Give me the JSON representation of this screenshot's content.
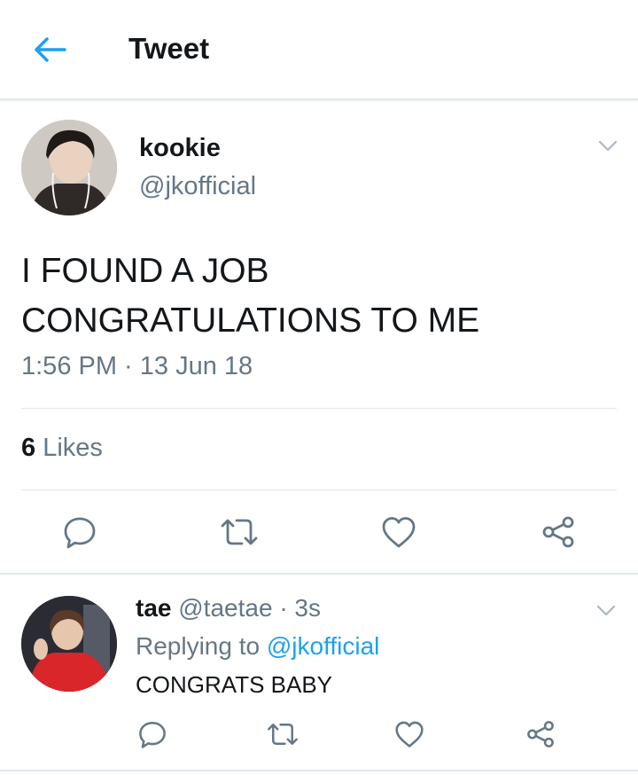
{
  "header": {
    "title": "Tweet",
    "back_icon": "arrow-left-icon",
    "accent": "#1da1f2"
  },
  "tweet": {
    "author": {
      "name": "kookie",
      "handle": "@jkofficial"
    },
    "text_lines": [
      "I FOUND A JOB",
      "CONGRATULATIONS TO ME"
    ],
    "timestamp": "1:56 PM · 13 Jun 18",
    "likes_count": "6",
    "likes_label": "Likes",
    "actions": [
      "reply-icon",
      "retweet-icon",
      "like-icon",
      "share-icon"
    ]
  },
  "reply": {
    "author": {
      "name": "tae",
      "handle": "@taetae",
      "time": "· 3s"
    },
    "replying_prefix": "Replying to",
    "replying_handle": "@jkofficial",
    "text": "CONGRATS BABY",
    "actions": [
      "reply-icon",
      "retweet-icon",
      "like-icon",
      "share-icon"
    ]
  }
}
